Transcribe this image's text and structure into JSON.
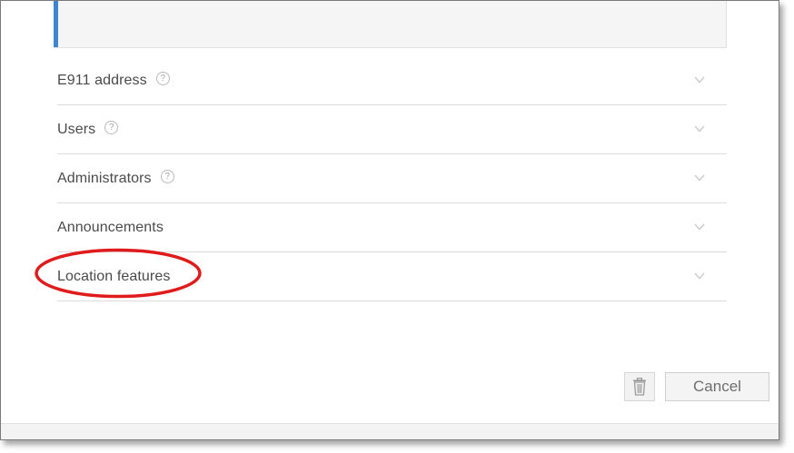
{
  "sections": [
    {
      "label": "E911 address",
      "has_help": true
    },
    {
      "label": "Users",
      "has_help": true
    },
    {
      "label": "Administrators",
      "has_help": true
    },
    {
      "label": "Announcements",
      "has_help": false
    },
    {
      "label": "Location features",
      "has_help": false
    }
  ],
  "help_glyph": "?",
  "footer": {
    "delete_icon": "trash-icon",
    "cancel_label": "Cancel"
  },
  "colors": {
    "accent": "#3f86d1",
    "callout": "#e01b1b",
    "text": "#4a4a4a"
  }
}
